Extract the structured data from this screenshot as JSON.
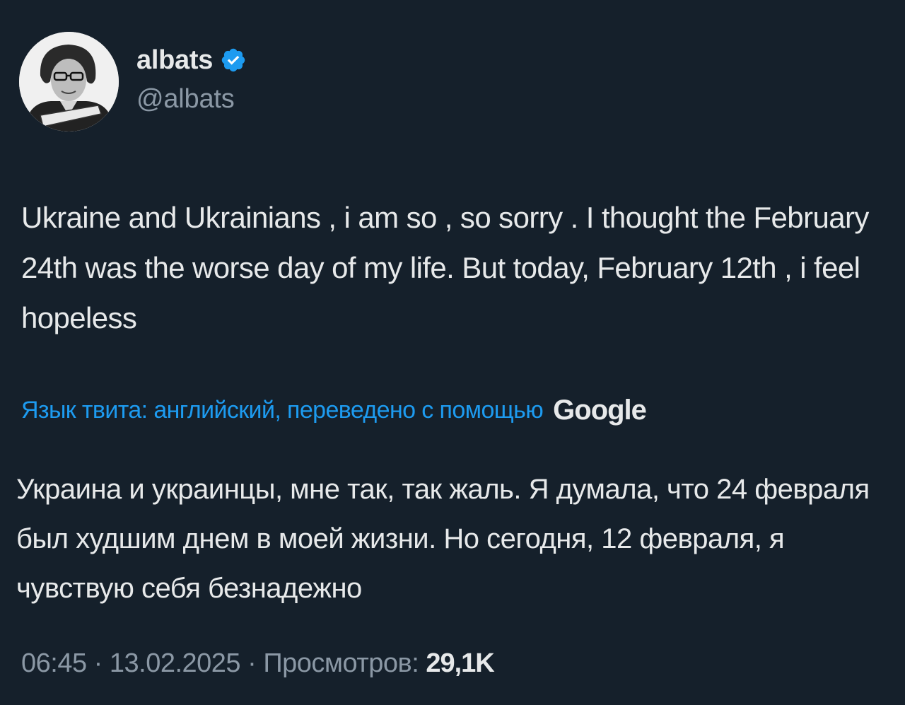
{
  "author": {
    "display_name": "albats",
    "handle": "@albats",
    "verified_icon": "verified-badge-icon",
    "verified_color": "#1d9bf0"
  },
  "tweet": {
    "text": "Ukraine and Ukrainians , i am so , so sorry . I thought the February 24th was the worse day of my life. But today, February 12th , i feel hopeless"
  },
  "translation": {
    "label": "Язык твита: английский, переведено с помощью",
    "provider": "Google",
    "text": "Украина и украинцы, мне так, так жаль. Я думала, что 24 февраля был худшим днем в моей жизни. Но сегодня, 12 февраля, я чувствую себя безнадежно"
  },
  "meta": {
    "time": "06:45",
    "separator1": " · ",
    "date": "13.02.2025",
    "separator2": " · ",
    "views_label": "Просмотров:",
    "views_count": "29,1K"
  },
  "colors": {
    "background": "#15202b",
    "text_primary": "#e7e9ea",
    "text_secondary": "#8b98a5",
    "accent": "#1d9bf0"
  }
}
